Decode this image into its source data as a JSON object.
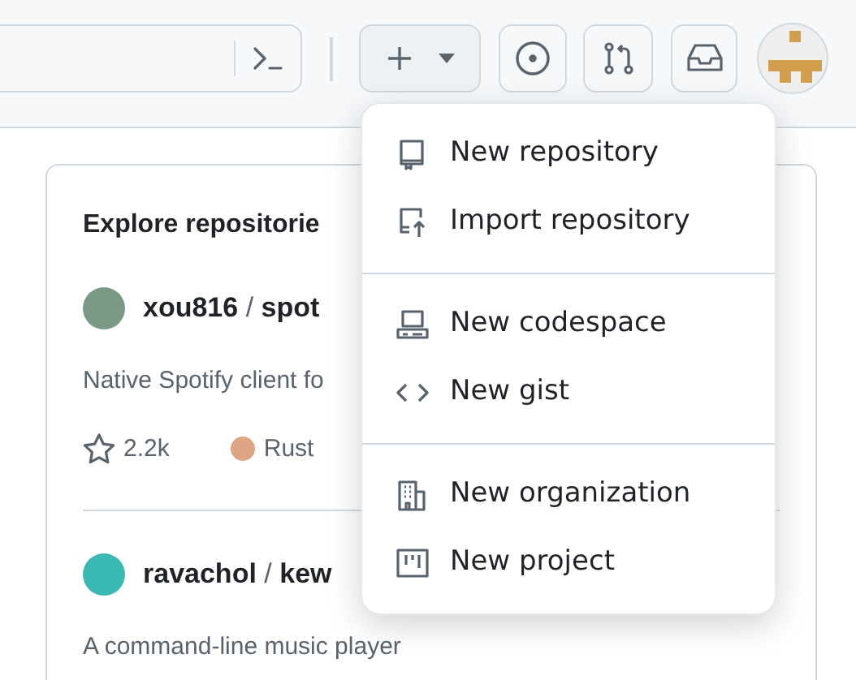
{
  "header": {
    "create_button": {
      "expanded": true
    }
  },
  "card": {
    "title": "Explore repositorie",
    "repos": [
      {
        "owner": "xou816",
        "separator": "/",
        "name": "spot",
        "description": "Native Spotify client fo",
        "stars": "2.2k",
        "language": "Rust",
        "color": "#dea584"
      },
      {
        "owner": "ravachol",
        "separator": "/",
        "name": "kew",
        "description": "A command-line music player"
      }
    ]
  },
  "menu": {
    "groups": [
      [
        {
          "kind": "repo",
          "label": "New repository"
        },
        {
          "kind": "import",
          "label": "Import repository"
        }
      ],
      [
        {
          "kind": "codespace",
          "label": "New codespace"
        },
        {
          "kind": "gist",
          "label": "New gist"
        }
      ],
      [
        {
          "kind": "org",
          "label": "New organization"
        },
        {
          "kind": "project",
          "label": "New project"
        }
      ]
    ]
  }
}
